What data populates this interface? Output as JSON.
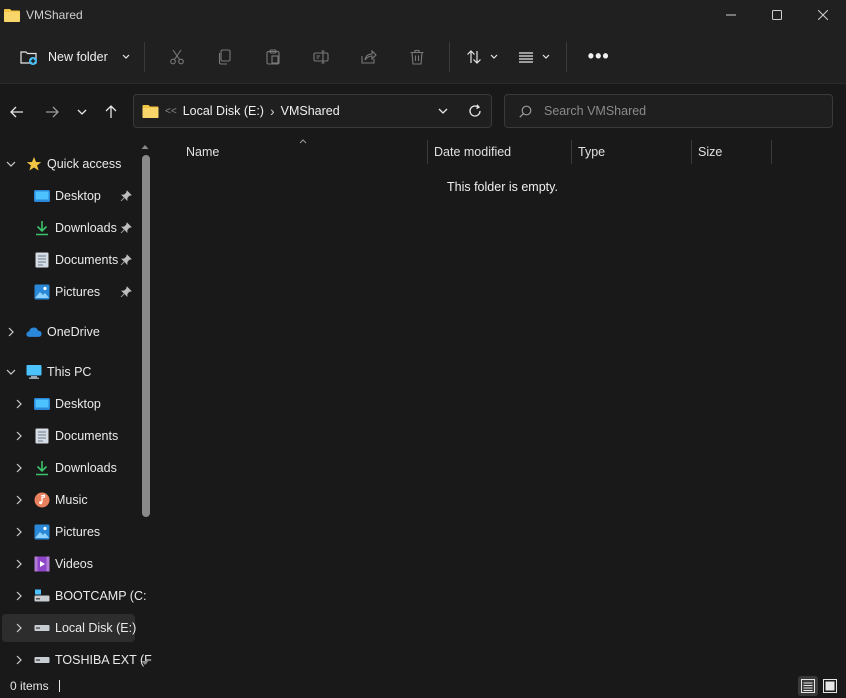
{
  "window": {
    "title": "VMShared"
  },
  "toolbar": {
    "new_folder_label": "New folder",
    "icons": [
      "cut-icon",
      "copy-icon",
      "paste-icon",
      "rename-icon",
      "share-icon",
      "delete-icon",
      "sort-icon",
      "view-icon",
      "more-icon"
    ],
    "more_label": "•••"
  },
  "address": {
    "overflow": "<<",
    "crumbs": [
      {
        "label": "Local Disk (E:)"
      },
      {
        "label": "VMShared"
      }
    ],
    "separator": "›"
  },
  "search": {
    "placeholder": "Search VMShared"
  },
  "nav": {
    "quick_access": {
      "label": "Quick access",
      "items": [
        {
          "label": "Desktop",
          "icon": "desktop-icon",
          "pinned": true
        },
        {
          "label": "Downloads",
          "icon": "download-icon",
          "pinned": true
        },
        {
          "label": "Documents",
          "icon": "document-icon",
          "pinned": true
        },
        {
          "label": "Pictures",
          "icon": "pictures-icon",
          "pinned": true
        }
      ]
    },
    "onedrive": {
      "label": "OneDrive"
    },
    "this_pc": {
      "label": "This PC",
      "items": [
        {
          "label": "Desktop",
          "icon": "desktop-icon"
        },
        {
          "label": "Documents",
          "icon": "document-icon"
        },
        {
          "label": "Downloads",
          "icon": "download-icon"
        },
        {
          "label": "Music",
          "icon": "music-icon"
        },
        {
          "label": "Pictures",
          "icon": "pictures-icon"
        },
        {
          "label": "Videos",
          "icon": "videos-icon"
        },
        {
          "label": "BOOTCAMP (C:",
          "icon": "drive-icon"
        },
        {
          "label": "Local Disk (E:)",
          "icon": "drive-icon",
          "selected": true
        },
        {
          "label": "TOSHIBA EXT (F",
          "icon": "drive-icon"
        }
      ]
    }
  },
  "columns": [
    {
      "label": "Name"
    },
    {
      "label": "Date modified"
    },
    {
      "label": "Type"
    },
    {
      "label": "Size"
    }
  ],
  "content": {
    "empty_message": "This folder is empty."
  },
  "status": {
    "item_count": "0 items"
  },
  "colors": {
    "background": "#191919",
    "chrome": "#202020",
    "folder_yellow": "#f4c542",
    "accent_blue": "#4cc2ff"
  }
}
